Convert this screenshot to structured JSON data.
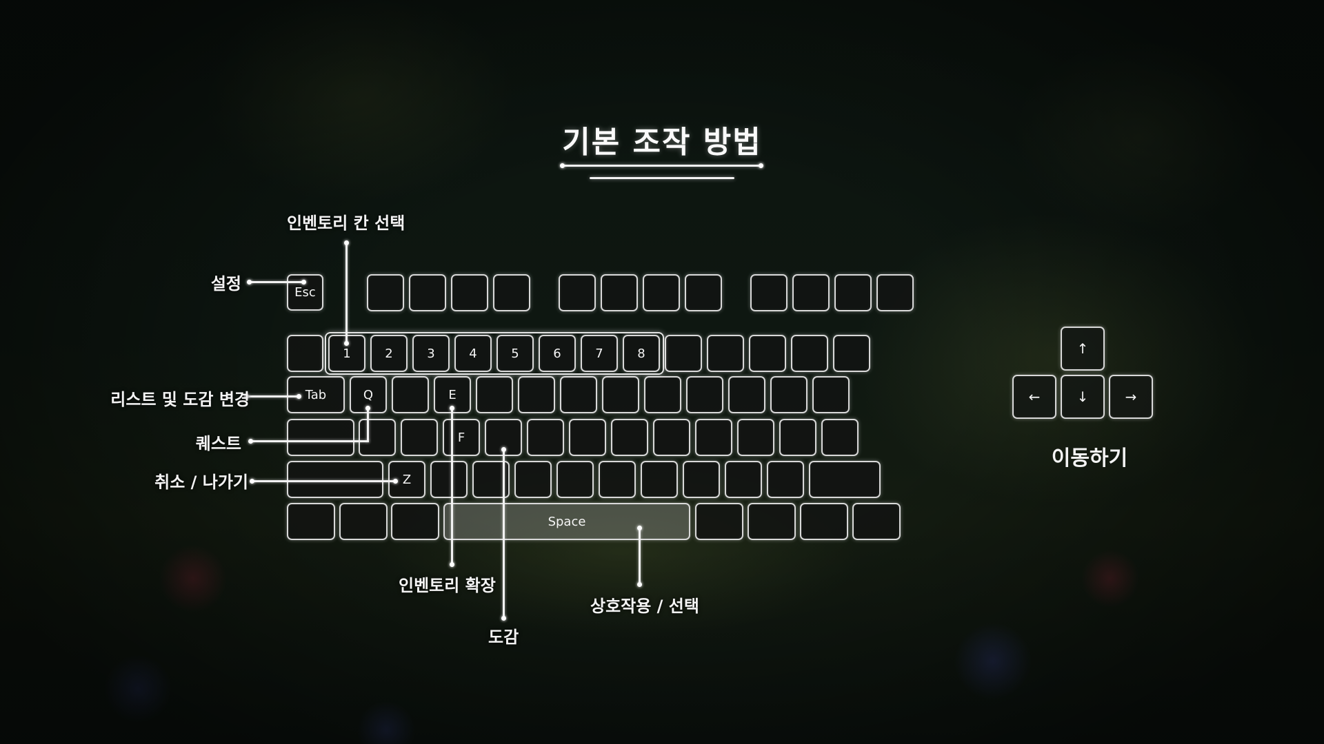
{
  "title": "기본 조작 방법",
  "keys": {
    "esc": "Esc",
    "n1": "1",
    "n2": "2",
    "n3": "3",
    "n4": "4",
    "n5": "5",
    "n6": "6",
    "n7": "7",
    "n8": "8",
    "tab": "Tab",
    "q": "Q",
    "e": "E",
    "f": "F",
    "z": "Z",
    "space": "Space"
  },
  "arrows": {
    "up": "↑",
    "left": "←",
    "down": "↓",
    "right": "→"
  },
  "labels": {
    "settings": "설정",
    "inventory_slot_select": "인벤토리 칸 선택",
    "list_codex_switch": "리스트 및 도감 변경",
    "quest": "퀘스트",
    "cancel_exit": "취소 / 나가기",
    "inventory_expand": "인벤토리 확장",
    "codex": "도감",
    "interact_select": "상호작용 / 선택",
    "move": "이동하기"
  }
}
